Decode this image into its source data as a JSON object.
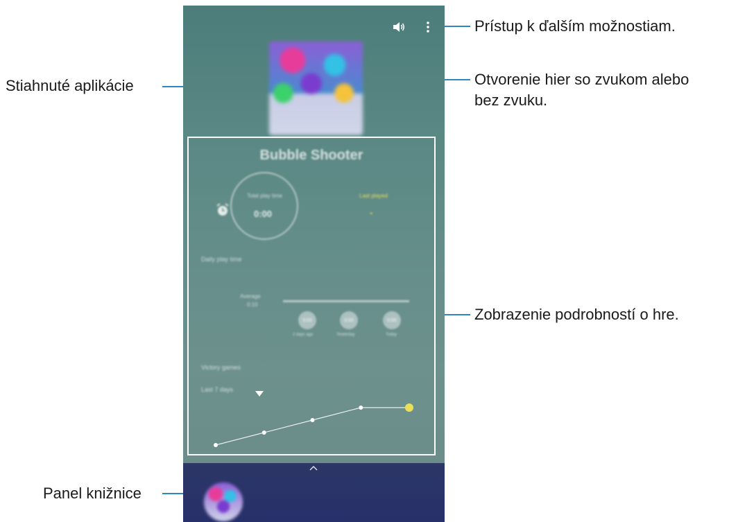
{
  "callouts": {
    "more_options": "Prístup k ďalším možnostiam.",
    "sound_line1": "Otvorenie hier so zvukom alebo",
    "sound_line2": "bez zvuku.",
    "downloaded_apps": "Stiahnuté aplikácie",
    "game_details": "Zobrazenie podrobností o hre.",
    "library_panel": "Panel knižnice"
  },
  "phone": {
    "sound_icon": "volume-icon",
    "more_icon": "more-vertical-icon",
    "details": {
      "game_title": "Bubble Shooter",
      "total_play_time_label": "Total play time",
      "total_play_time_value": "0:00",
      "last_played_label": "Last played",
      "last_played_value": "-",
      "daily_play_time_label": "Daily play time",
      "average_label": "Average",
      "average_value": "0:10",
      "stats": [
        {
          "value": "0:00",
          "label": "2 days ago"
        },
        {
          "value": "0:00",
          "label": "Yesterday"
        },
        {
          "value": "0:00",
          "label": "Today"
        }
      ],
      "history_label": "Victory games",
      "range_label": "Last 7 days",
      "dropdown_icon": "caret-down-icon"
    },
    "library": {
      "expand_icon": "chevron-up-icon"
    }
  },
  "colors": {
    "callout_line": "#2e86c1",
    "highlight": "#e8e05a",
    "library_bg": "#27306a"
  },
  "chart_data": {
    "type": "line",
    "values": [
      1,
      2,
      3,
      4,
      4
    ]
  }
}
